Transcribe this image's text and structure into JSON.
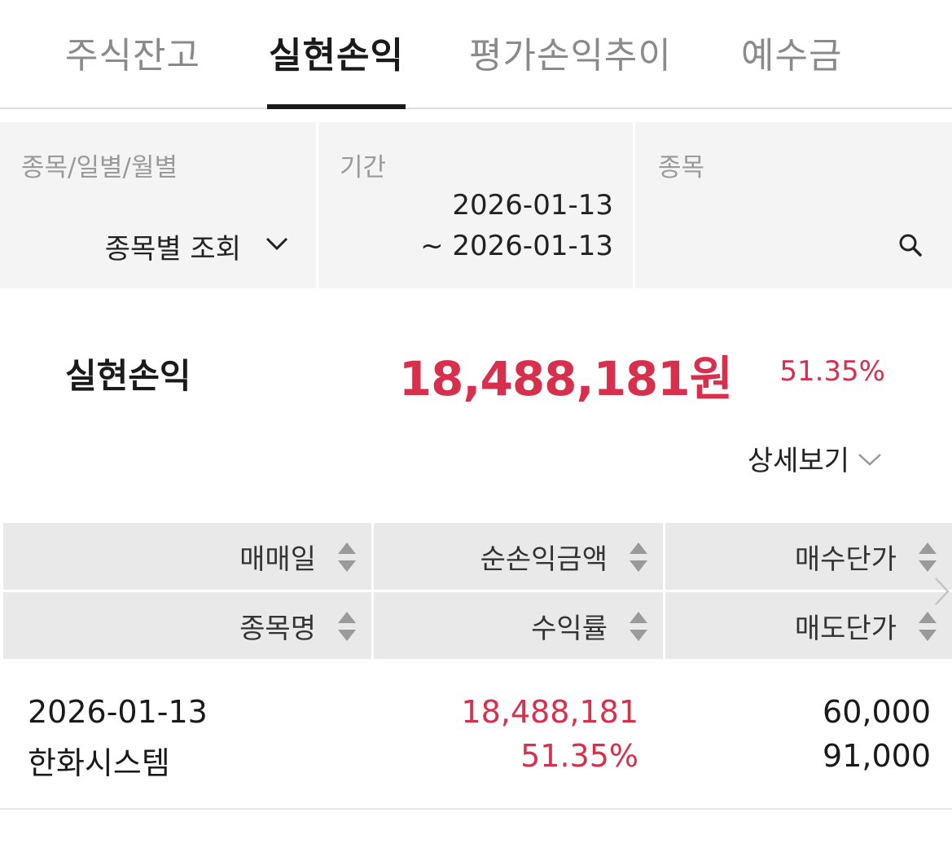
{
  "tabs": [
    {
      "label": "주식잔고",
      "active": false
    },
    {
      "label": "실현손익",
      "active": true
    },
    {
      "label": "평가손익추이",
      "active": false
    },
    {
      "label": "예수금",
      "active": false
    }
  ],
  "filters": {
    "view_mode": {
      "label": "종목/일별/월별",
      "value": "종목별 조회"
    },
    "period": {
      "label": "기간",
      "start": "2026-01-13",
      "end": "~ 2026-01-13"
    },
    "stock": {
      "label": "종목",
      "value": ""
    }
  },
  "summary": {
    "label": "실현손익",
    "amount": "18,488,181원",
    "rate": "51.35%",
    "detail_toggle": "상세보기"
  },
  "table": {
    "headers": {
      "row1": [
        "매매일",
        "순손익금액",
        "매수단가"
      ],
      "row2": [
        "종목명",
        "수익률",
        "매도단가"
      ]
    },
    "rows": [
      {
        "trade_date": "2026-01-13",
        "stock_name": "한화시스템",
        "net_profit": "18,488,181",
        "return_rate": "51.35%",
        "buy_price": "60,000",
        "sell_price": "91,000"
      }
    ]
  },
  "colors": {
    "accent_red": "#d8304c",
    "active_tab": "#1a1a1a",
    "inactive_tab": "#8a8a8a",
    "filter_bg": "#f4f4f4",
    "header_bg": "#e9e9e9"
  },
  "icons": [
    "chevron-down-icon",
    "search-icon",
    "sort-icon",
    "chevron-right-icon"
  ]
}
